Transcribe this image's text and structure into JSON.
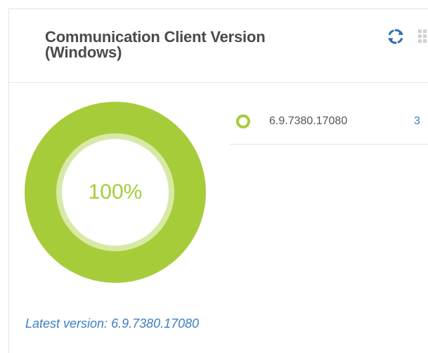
{
  "widget": {
    "title_line1": "Communication Client Version",
    "title_line2": "(Windows)",
    "refresh_icon": "refresh-icon",
    "layout_icon": "grid-icon"
  },
  "donut": {
    "center_label": "100%",
    "ring_color": "#a6cc3a",
    "inner_ring_color": "#d8e9a6",
    "slices": [
      {
        "label": "6.9.7380.17080",
        "percent": 100,
        "count": 3
      }
    ]
  },
  "legend": {
    "items": [
      {
        "label": "6.9.7380.17080",
        "count": "3",
        "color": "#a6cc3a"
      }
    ]
  },
  "footer": {
    "latest_version_text": "Latest version: 6.9.7380.17080"
  },
  "colors": {
    "accent_green": "#a6cc3a",
    "link_blue": "#3b7fc4",
    "title_gray": "#4a4a4a"
  }
}
